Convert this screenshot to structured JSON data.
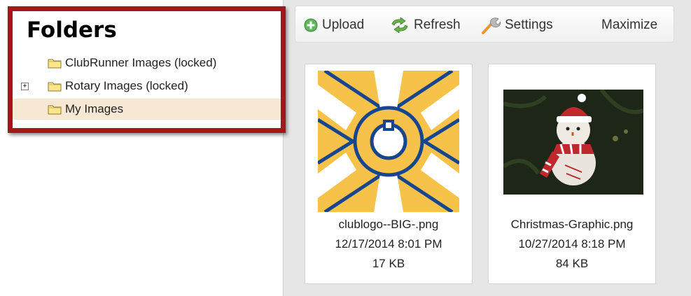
{
  "folders": {
    "title": "Folders",
    "items": [
      {
        "label": "ClubRunner Images (locked)",
        "expandable": false,
        "selected": false
      },
      {
        "label": "Rotary Images (locked)",
        "expandable": true,
        "selected": false
      },
      {
        "label": "My Images",
        "expandable": false,
        "selected": true
      }
    ],
    "expander_symbol": "+"
  },
  "toolbar": {
    "upload_label": "Upload",
    "refresh_label": "Refresh",
    "settings_label": "Settings",
    "maximize_label": "Maximize"
  },
  "files": [
    {
      "name": "clublogo--BIG-.png",
      "date": "12/17/2014 8:01 PM",
      "size": "17 KB",
      "thumb": "rotary-wheel-logo"
    },
    {
      "name": "Christmas-Graphic.png",
      "date": "10/27/2014 8:18 PM",
      "size": "84 KB",
      "thumb": "snowman-ornament-photo"
    }
  ],
  "colors": {
    "highlight_border": "#a5151b",
    "selected_row": "#f7e8d3",
    "rotary_gold": "#f7c24a",
    "rotary_blue": "#17458f"
  }
}
